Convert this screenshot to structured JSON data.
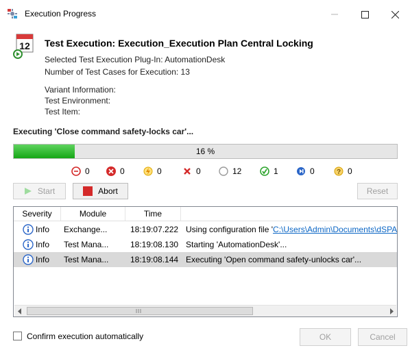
{
  "window": {
    "title": "Execution Progress"
  },
  "header": {
    "icon_day": "12",
    "title": "Test Execution: Execution_Execution Plan Central Locking",
    "plugin": "Selected Test Execution Plug-In: AutomationDesk",
    "count": "Number of Test Cases for Execution: 13",
    "variant": "Variant Information:",
    "environment": "Test Environment:",
    "item": "Test Item:"
  },
  "status": {
    "text": "Executing 'Close command safety-locks car'..."
  },
  "progress": {
    "value": 0.16,
    "label": "16 %"
  },
  "counters": [
    {
      "icon": "minus-circle-icon",
      "value": "0"
    },
    {
      "icon": "error-x-icon",
      "value": "0"
    },
    {
      "icon": "lightning-icon",
      "value": "0"
    },
    {
      "icon": "fail-x-icon",
      "value": "0"
    },
    {
      "icon": "not-executed-circle-icon",
      "value": "12"
    },
    {
      "icon": "passed-check-icon",
      "value": "1"
    },
    {
      "icon": "skip-icon",
      "value": "0"
    },
    {
      "icon": "question-icon",
      "value": "0"
    }
  ],
  "toolbar": {
    "start": "Start",
    "abort": "Abort",
    "reset": "Reset"
  },
  "log": {
    "columns": [
      "Severity",
      "Module",
      "Time"
    ],
    "rows": [
      {
        "severity": "Info",
        "module": "Exchange...",
        "time": "18:19:07.222",
        "message_prefix": "Using configuration file '",
        "message_link": "C:\\Users\\Admin\\Documents\\dSPAC"
      },
      {
        "severity": "Info",
        "module": "Test Mana...",
        "time": "18:19:08.130",
        "message": "Starting 'AutomationDesk'..."
      },
      {
        "severity": "Info",
        "module": "Test Mana...",
        "time": "18:19:08.144",
        "message": "Executing 'Open command safety-unlocks car'..."
      }
    ]
  },
  "footer": {
    "confirm_label": "Confirm execution automatically",
    "ok": "OK",
    "cancel": "Cancel"
  }
}
